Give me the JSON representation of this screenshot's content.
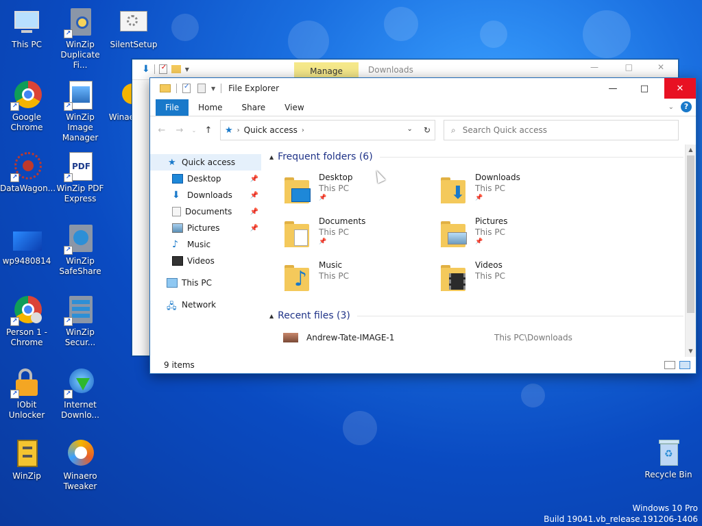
{
  "desktop": {
    "icons": [
      {
        "label": "This PC"
      },
      {
        "label": "WinZip Duplicate Fi..."
      },
      {
        "label": "SilentSetup"
      },
      {
        "label": "Google Chrome"
      },
      {
        "label": "WinZip Image Manager"
      },
      {
        "label": "Winae"
      },
      {
        "label": "DataWagon..."
      },
      {
        "label": "WinZip PDF Express"
      },
      {
        "label": "wp9480814"
      },
      {
        "label": "WinZip SafeShare"
      },
      {
        "label": "Person 1 - Chrome"
      },
      {
        "label": "WinZip Secur..."
      },
      {
        "label": "IObit Unlocker"
      },
      {
        "label": "Internet Downlo..."
      },
      {
        "label": "WinZip"
      },
      {
        "label": "Winaero Tweaker"
      },
      {
        "label": "Recycle Bin"
      }
    ],
    "watermark": {
      "line1": "Windows 10 Pro",
      "line2": "Build 19041.vb_release.191206-1406"
    }
  },
  "back_window": {
    "manage_label": "Manage",
    "title": "Downloads"
  },
  "window": {
    "title": "File Explorer",
    "ribbon_tabs": [
      "File",
      "Home",
      "Share",
      "View"
    ],
    "address": {
      "crumb": "Quick access"
    },
    "search": {
      "placeholder": "Search Quick access"
    },
    "nav": {
      "quick_access": "Quick access",
      "items": [
        "Desktop",
        "Downloads",
        "Documents",
        "Pictures",
        "Music",
        "Videos"
      ],
      "this_pc": "This PC",
      "network": "Network"
    },
    "frequent": {
      "title": "Frequent folders (6)",
      "folders": [
        {
          "name": "Desktop",
          "location": "This PC"
        },
        {
          "name": "Downloads",
          "location": "This PC"
        },
        {
          "name": "Documents",
          "location": "This PC"
        },
        {
          "name": "Pictures",
          "location": "This PC"
        },
        {
          "name": "Music",
          "location": "This PC"
        },
        {
          "name": "Videos",
          "location": "This PC"
        }
      ]
    },
    "recent": {
      "title": "Recent files (3)",
      "files": [
        {
          "name": "Andrew-Tate-IMAGE-1",
          "path": "This PC\\Downloads"
        }
      ]
    },
    "status": "9 items"
  },
  "colors": {
    "accent": "#1979ca",
    "close": "#e81123",
    "folder": "#f4c95b",
    "group_title": "#1e3287"
  }
}
